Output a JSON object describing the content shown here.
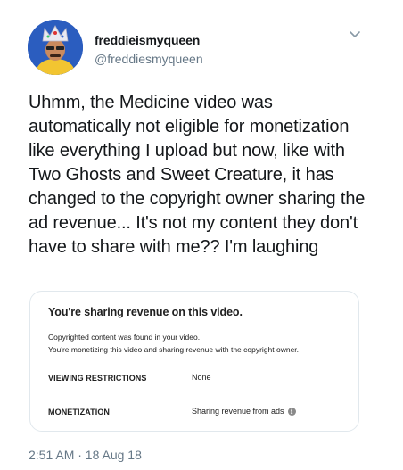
{
  "user": {
    "display_name": "freddieismyqueen",
    "handle": "@freddiesmyqueen"
  },
  "tweet": {
    "text": "Uhmm, the Medicine video was automatically not eligible for monetization like everything I upload but now, like with Two Ghosts and Sweet Creature, it has changed to the copyright owner sharing the ad revenue... It's not my content they don't have to share with me?? I'm laughing",
    "timestamp": "2:51 AM · 18 Aug 18"
  },
  "card": {
    "title": "You're sharing revenue on this video.",
    "desc_line1": "Copyrighted content was found in your video.",
    "desc_line2": "You're monetizing this video and sharing revenue with the copyright owner.",
    "viewing_label": "VIEWING RESTRICTIONS",
    "viewing_value": "None",
    "monetization_label": "MONETIZATION",
    "monetization_value": "Sharing revenue from ads",
    "info_icon": "info-icon"
  },
  "colors": {
    "text": "#14171a",
    "secondary": "#657786",
    "card_border": "#e1e8ed"
  }
}
